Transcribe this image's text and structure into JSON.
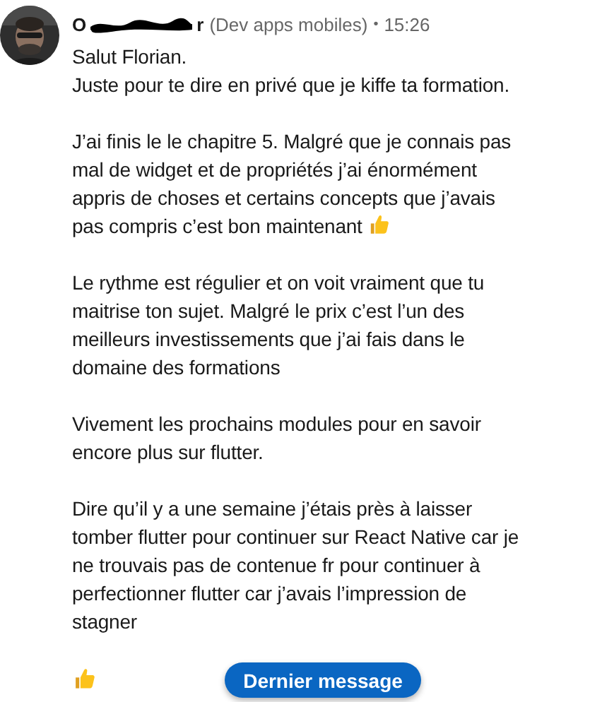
{
  "message": {
    "sender_start": "O",
    "sender_end": "r",
    "redacted": true,
    "headline": "(Dev apps mobiles)",
    "separator": "•",
    "time": "15:26",
    "paragraphs": [
      {
        "kind": "text",
        "lines": [
          "Salut Florian.",
          "Juste pour te dire en privé que je kiffe ta formation."
        ]
      },
      {
        "kind": "text",
        "lines": [
          "J’ai finis le le chapitre 5. Malgré que je connais pas",
          "mal de widget et de propriétés j’ai énormément",
          "appris de choses et certains concepts que j’avais",
          "pas compris c’est bon maintenant"
        ],
        "thumbs_up": true
      },
      {
        "kind": "text",
        "lines": [
          "Le rythme est régulier et on voit vraiment que tu",
          "maitrise ton sujet. Malgré le prix c’est l’un des",
          "meilleurs investissements que j’ai fais dans le",
          "domaine des formations"
        ]
      },
      {
        "kind": "text",
        "lines": [
          "Vivement les prochains modules pour en savoir",
          "encore plus sur flutter."
        ]
      },
      {
        "kind": "text",
        "lines": [
          "Dire qu’il y a une semaine j’étais près à laisser",
          "tomber flutter pour continuer sur React Native car je",
          "ne trouvais pas de contenue fr pour continuer à",
          "perfectionner flutter car j’avais l’impression de",
          "stagner"
        ]
      },
      {
        "kind": "emoji"
      }
    ]
  },
  "jump_button": "Dernier message"
}
